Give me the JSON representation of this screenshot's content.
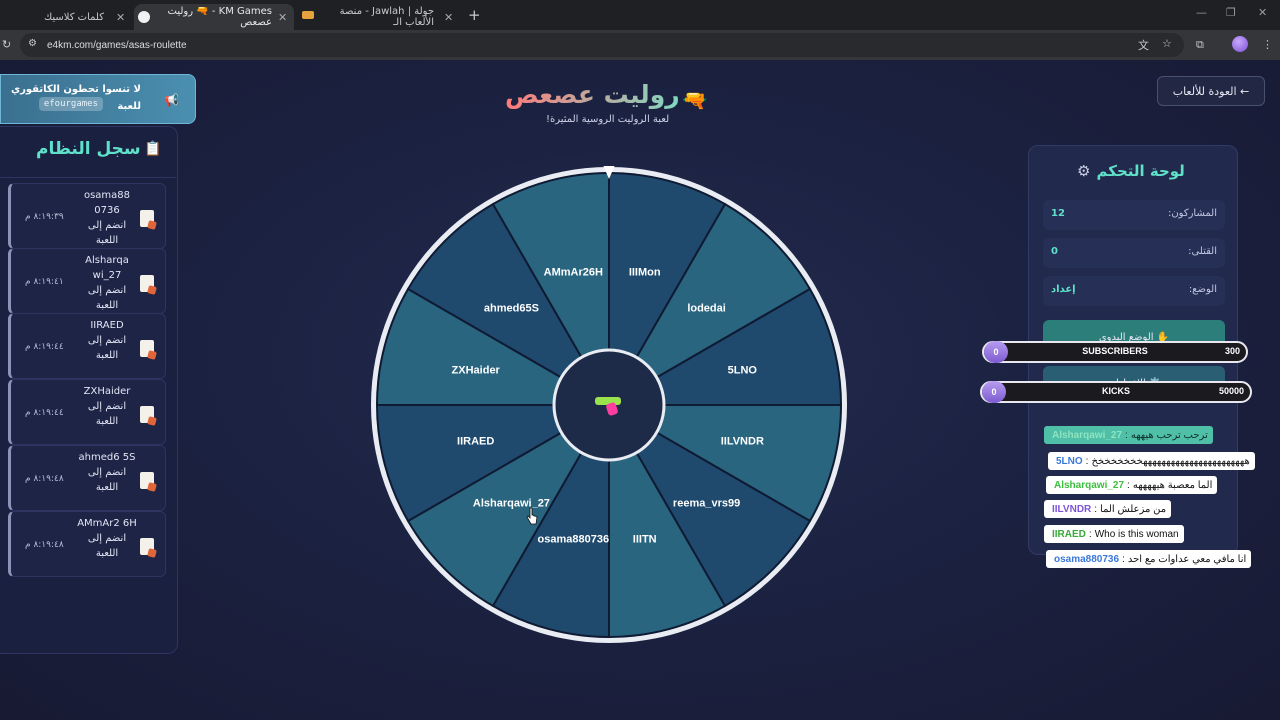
{
  "browser": {
    "tabs": [
      {
        "title": "كلمات كلاسيك",
        "active": false
      },
      {
        "title": "KM Games - 🔫 روليت عصعص",
        "active": true
      },
      {
        "title": "جولة | Jawlah - منصة الألعاب الـ",
        "active": false
      }
    ],
    "url": "e4km.com/games/asas-roulette"
  },
  "notice": {
    "line1": "لا تنسوا تحطون الكاتقوري",
    "line2": "للعبة",
    "code": "efourgames",
    "icon": "megaphone-icon"
  },
  "log": {
    "title": "سجل النظام",
    "icon": "clipboard-icon",
    "items": [
      {
        "user": "osama88 0736",
        "action": "انضم إلى اللعبة",
        "time": "٨:١٩:٣٩ م"
      },
      {
        "user": "Alsharqa wi_27",
        "action": "انضم إلى اللعبة",
        "time": "٨:١٩:٤١ م"
      },
      {
        "user": "IIRAED",
        "action": "انضم إلى اللعبة",
        "time": "٨:١٩:٤٤ م"
      },
      {
        "user": "ZXHaider",
        "action": "انضم إلى اللعبة",
        "time": "٨:١٩:٤٤ م"
      },
      {
        "user": "ahmed6 5S",
        "action": "انضم إلى اللعبة",
        "time": "٨:١٩:٤٨ م"
      },
      {
        "user": "AMmAr2 6H",
        "action": "انضم إلى اللعبة",
        "time": "٨:١٩:٤٨ م"
      }
    ]
  },
  "header": {
    "title": "روليت عصعص",
    "subtitle": "لعبة الروليت الروسية المثيرة!",
    "back": "← العودة للألعاب"
  },
  "wheel": {
    "players": [
      "IIIMon",
      "lodedai",
      "5LNO",
      "IILVNDR",
      "reema_vrs99",
      "IIITN",
      "osama880736",
      "Alsharqawi_27",
      "IIRAED",
      "ZXHaider",
      "ahmed65S",
      "AMmAr26H"
    ],
    "center_icon": "water-gun-icon"
  },
  "control": {
    "title": "لوحة التحكم",
    "icon": "gear-icon",
    "stats": [
      {
        "label": "المشاركون:",
        "value": "12"
      },
      {
        "label": "القتلى:",
        "value": "0"
      },
      {
        "label": "الوضع:",
        "value": "إعداد"
      }
    ],
    "manual_mode": "✋ الوضع اليدوي",
    "settings": "⚙️ الإعدادات"
  },
  "overlay": {
    "bars": [
      {
        "label": "SUBSCRIBERS",
        "current": "0",
        "goal": "300"
      },
      {
        "label": "KICKS",
        "current": "0",
        "goal": "50000"
      }
    ],
    "chat": [
      {
        "user": "Alsharqawi_27",
        "text": "ترحب ترحب هيههه",
        "color": "#8fe3c0",
        "bg": "#4fbfa8"
      },
      {
        "user": "5LNO",
        "text": "هههههههههههههههههههههههخخخخخخخخ",
        "color": "#3a78d8",
        "bg": "#ffffff"
      },
      {
        "user": "Alsharqawi_27",
        "text": "الما معصبة هيههههه",
        "color": "#3fbf3f",
        "bg": "#ffffff"
      },
      {
        "user": "IILVNDR",
        "text": "من مزعلش الما",
        "color": "#7d55d8",
        "bg": "#ffffff"
      },
      {
        "user": "IIRAED",
        "text": "Who is this woman",
        "color": "#3aa83a",
        "bg": "#ffffff"
      },
      {
        "user": "osama880736",
        "text": "انا مافي معي عداوات مع احد",
        "color": "#3a78d8",
        "bg": "#ffffff"
      }
    ]
  }
}
